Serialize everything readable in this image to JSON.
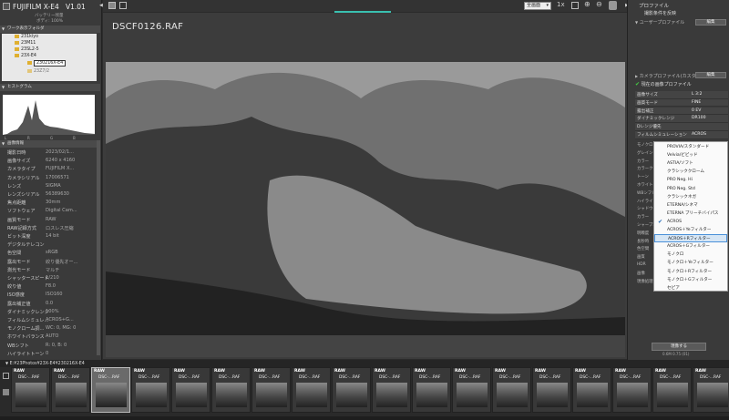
{
  "left": {
    "app_title": "FUJIFILM X-E4",
    "version": "V1.01",
    "battery_label": "バッテリー残量",
    "battery_value": "ボディ: 100%",
    "folder_header": "ワーク表示フォルダ",
    "tree": [
      "231kiyo",
      "23M11",
      "23SL2-5",
      "23X-E4",
      "230216X-E4",
      "23Z7/2"
    ],
    "histogram_header": "ヒストグラム",
    "hist_letters": [
      "L",
      "R",
      "G",
      "B"
    ],
    "exif_header": "画像情報",
    "exif": [
      [
        "撮影日時",
        "2023/02/1..."
      ],
      [
        "画像サイズ",
        "6240 x 4160"
      ],
      [
        "カメラタイプ",
        "FUJIFILM X..."
      ],
      [
        "カメラシリアル",
        "17006571"
      ],
      [
        "レンズ",
        "SIGMA"
      ],
      [
        "レンズシリアル",
        "56389630"
      ],
      [
        "焦点距離",
        "30mm"
      ],
      [
        "ソフトウェア",
        "Digital Cam..."
      ],
      [
        "画質モード",
        "RAW"
      ],
      [
        "RAW記録方式",
        "ロスレス圧縮"
      ],
      [
        "ビット深度",
        "14 bit"
      ],
      [
        "デジタルテレコン",
        ""
      ],
      [
        "色空間",
        "sRGB"
      ],
      [
        "露出モード",
        "絞り優先オー..."
      ],
      [
        "測光モード",
        "マルチ"
      ],
      [
        "シャッタースピード",
        "1/210"
      ],
      [
        "絞り値",
        "F8.0"
      ],
      [
        "ISO感度",
        "ISO160"
      ],
      [
        "露出補正値",
        "0.0"
      ],
      [
        "ダイナミックレンジ",
        "100%"
      ],
      [
        "フィルムシミュレ...",
        "ACROS+G..."
      ],
      [
        "モノクローム調...",
        "WC: 0, MG: 0"
      ],
      [
        "ホワイトバランス",
        "AUTO"
      ],
      [
        "WBシフト",
        "R: 0, B: 0"
      ],
      [
        "ハイライトトーン",
        "0"
      ]
    ]
  },
  "toolbar": {
    "display_mode": "全画面"
  },
  "viewer": {
    "filename": "DSCF0126.RAF"
  },
  "right": {
    "profile_title": "プロファイル",
    "shoot_reflect": "撮影条件を反映",
    "user_profile": "ユーザープロファイル",
    "edit_btn": "編集",
    "camera_profile": "カメラプロファイル(カスタム)",
    "current_profile": "現在の画像プロファイル",
    "settings": [
      [
        "画像サイズ",
        "L 3:2"
      ],
      [
        "画質モード",
        "FINE"
      ],
      [
        "露出補正",
        "0 EV"
      ],
      [
        "ダイナミックレンジ",
        "DR100"
      ],
      [
        "Dレンジ優先",
        ""
      ],
      [
        "フィルムシミュレーション",
        "ACROS"
      ]
    ],
    "hidden_labels": [
      "モノクロ",
      "グレイン",
      "カラー",
      "カラーク",
      "トーン",
      "ホワイト",
      "WBシフト",
      "ハイライト",
      "シャドウ",
      "カラー",
      "シャープネス",
      "明瞭度",
      "長秒時",
      "色空間",
      "画質",
      "HDR",
      "画像",
      "現像処理"
    ],
    "develop_btn": "現像する",
    "footer": "0.6M 0.75 (01)"
  },
  "dropdown": {
    "options": [
      "PROVIA/スタンダード",
      "Velvia/ビビッド",
      "ASTIA/ソフト",
      "クラシッククローム",
      "PRO Neg. Hi",
      "PRO Neg. Std",
      "クラシックネガ",
      "ETERNA/シネマ",
      "ETERNA ブリーチバイパス",
      "ACROS",
      "ACROS＋Yeフィルター",
      "ACROS＋Rフィルター",
      "ACROS＋Gフィルター",
      "モノクロ",
      "モノクロ＋Yeフィルター",
      "モノクロ＋Rフィルター",
      "モノクロ＋Gフィルター",
      "セピア"
    ],
    "checked_index": 9,
    "highlighted_index": 11
  },
  "strip": {
    "path": "E:¥23Photos¥23X-E4¥230216X-E4",
    "thumb_raw": "RAW",
    "thumb_name": "DSC-...RAF",
    "thumb_count": 18,
    "selected_index": 2
  }
}
